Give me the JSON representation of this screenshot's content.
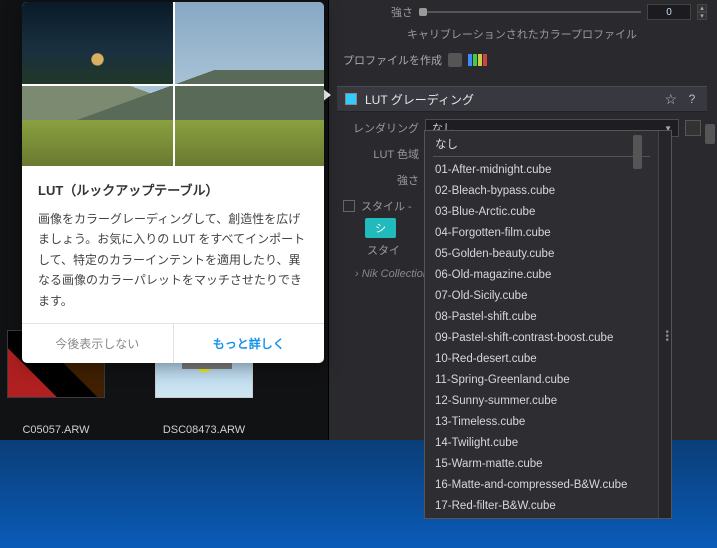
{
  "top": {
    "strength_label": "強さ",
    "strength_value": "0",
    "calibrated_profile": "キャリブレーションされたカラープロファイル",
    "create_profile": "プロファイルを作成"
  },
  "section": {
    "title": "LUT グレーディング",
    "star": "☆",
    "help": "?"
  },
  "props": {
    "rendering_label": "レンダリング",
    "rendering_value": "なし",
    "lut_gamut_label": "LUT 色域",
    "strength2_label": "強さ",
    "style_label": "スタイル -",
    "sync_btn": "シ",
    "style_sub": "スタイ",
    "nik": "Nik Collection"
  },
  "dropdown": {
    "none": "なし",
    "items": [
      "01-After-midnight.cube",
      "02-Bleach-bypass.cube",
      "03-Blue-Arctic.cube",
      "04-Forgotten-film.cube",
      "05-Golden-beauty.cube",
      "06-Old-magazine.cube",
      "07-Old-Sicily.cube",
      "08-Pastel-shift.cube",
      "09-Pastel-shift-contrast-boost.cube",
      "10-Red-desert.cube",
      "11-Spring-Greenland.cube",
      "12-Sunny-summer.cube",
      "13-Timeless.cube",
      "14-Twilight.cube",
      "15-Warm-matte.cube",
      "16-Matte-and-compressed-B&W.cube",
      "17-Red-filter-B&W.cube"
    ]
  },
  "thumbs": {
    "a": "C05057.ARW",
    "b": "DSC08473.ARW"
  },
  "tooltip": {
    "title": "LUT（ルックアップテーブル）",
    "body": "画像をカラーグレーディングして、創造性を広げましょう。お気に入りの LUT をすべてインポートして、特定のカラーインテントを適用したり、異なる画像のカラーパレットをマッチさせたりできます。",
    "dont_show": "今後表示しない",
    "more": "もっと詳しく"
  }
}
